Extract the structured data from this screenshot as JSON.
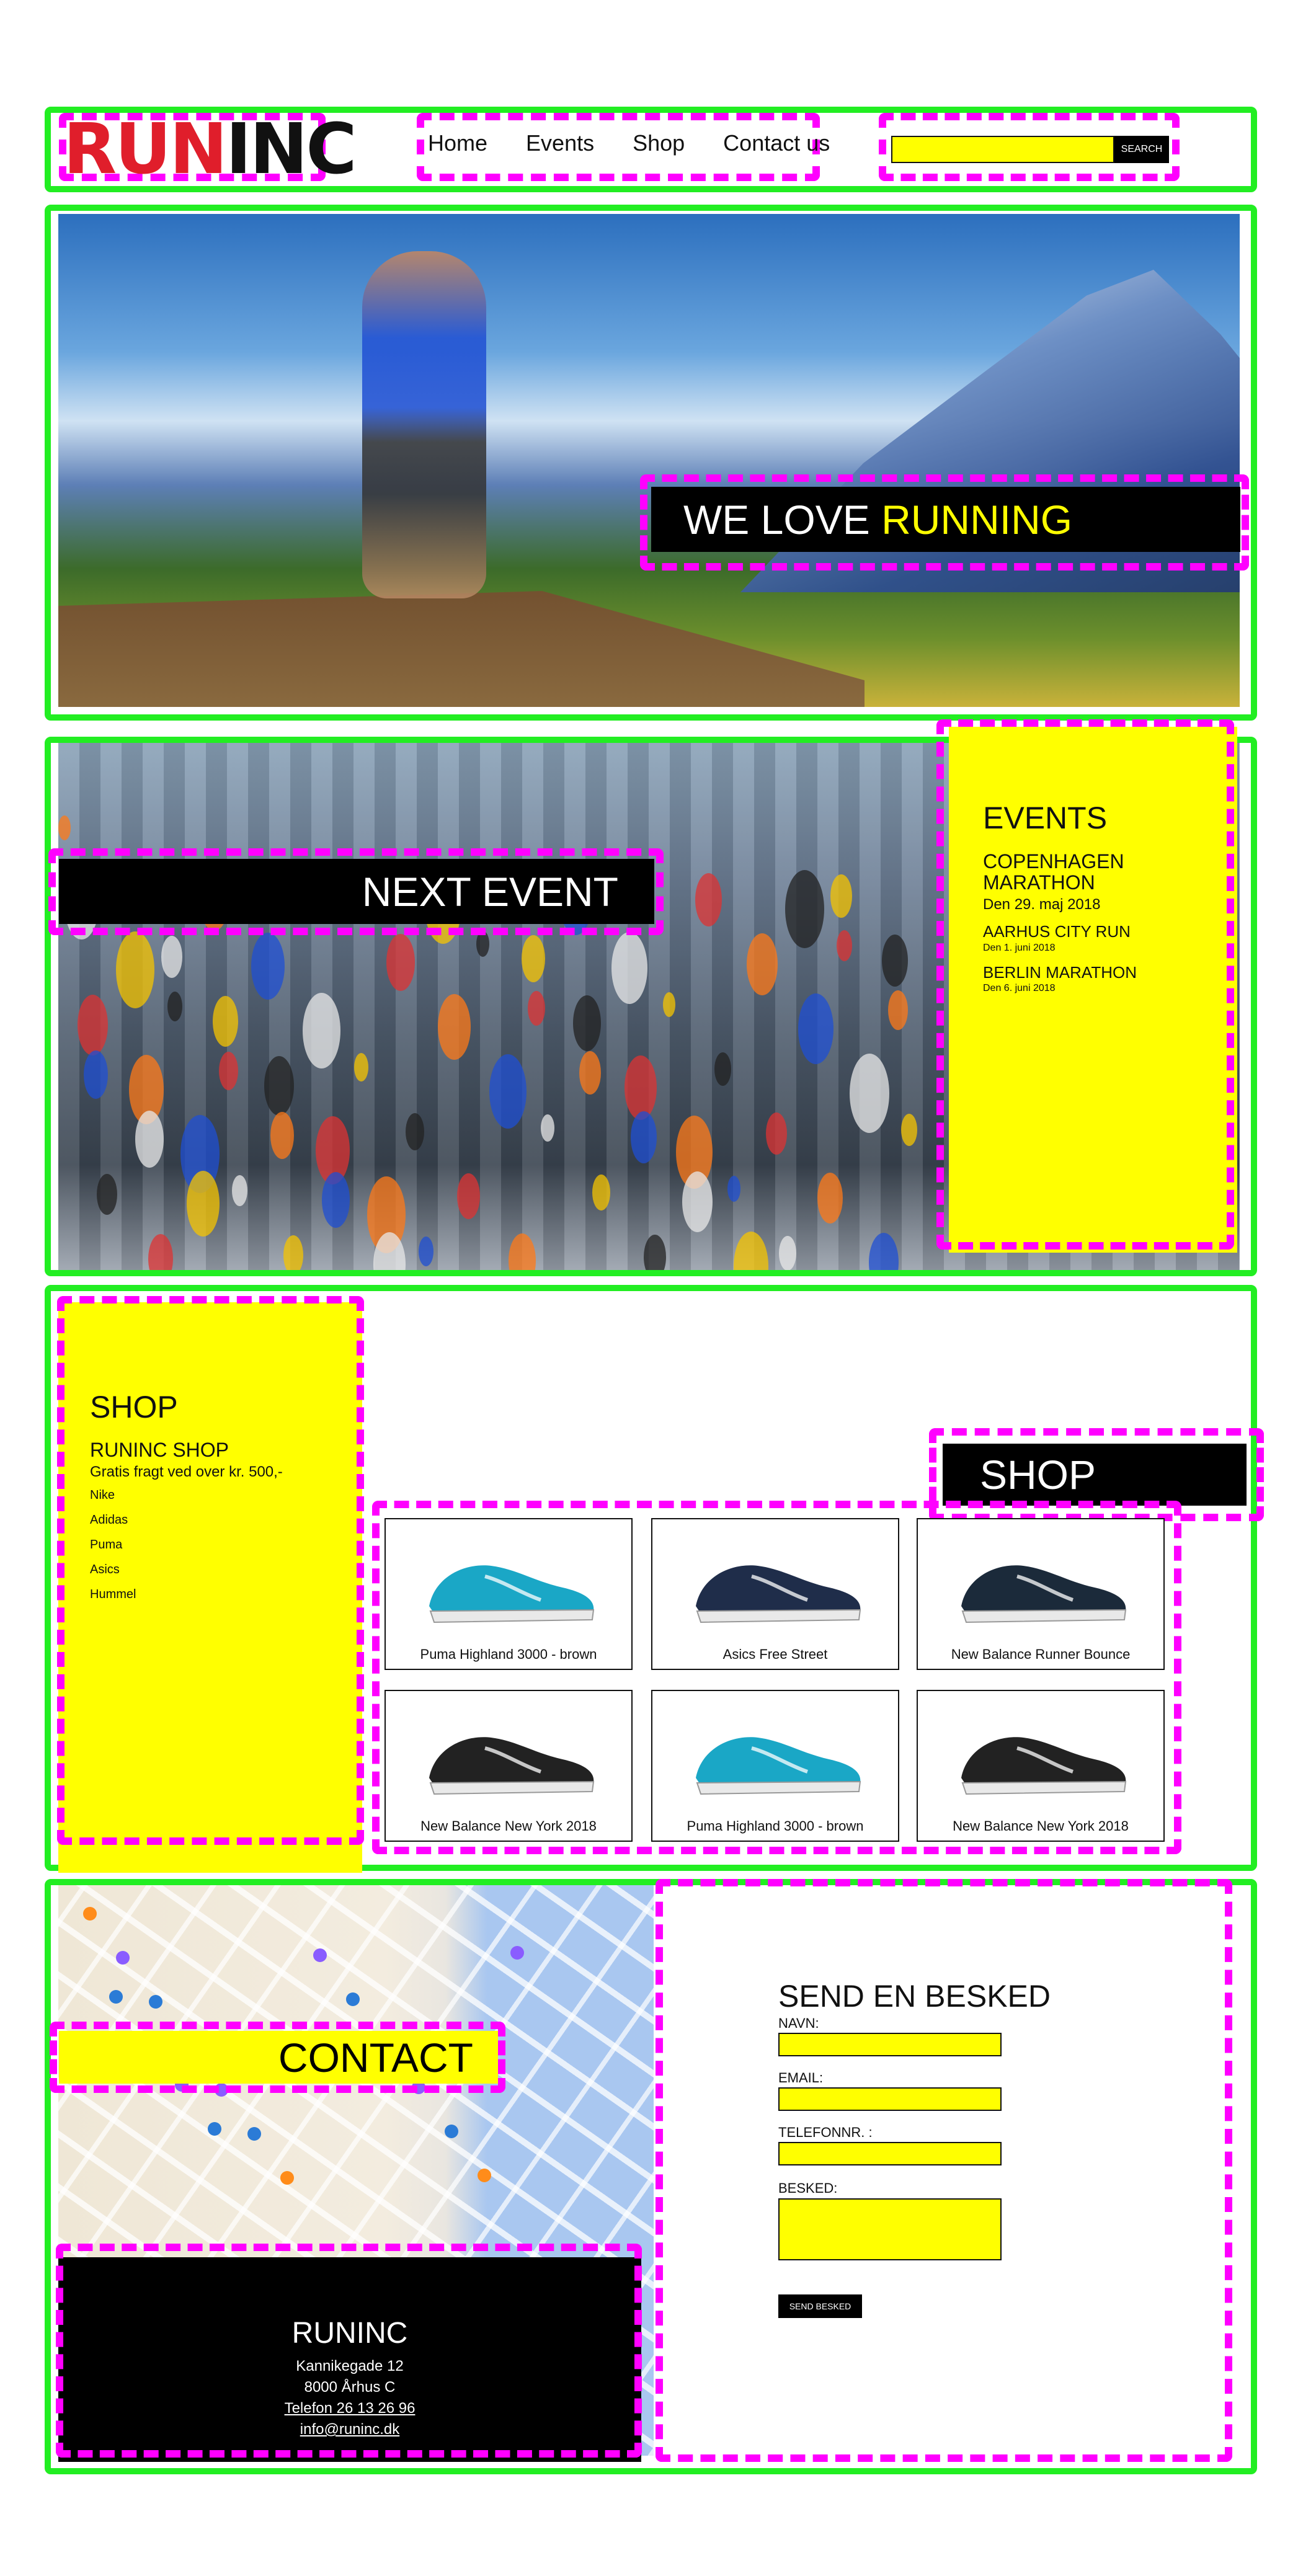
{
  "header": {
    "logo_run": "RUN",
    "logo_inc": "INC",
    "nav": [
      "Home",
      "Events",
      "Shop",
      "Contact us"
    ],
    "search_button": "SEARCH"
  },
  "hero": {
    "banner_prefix": "WE LOVE",
    "banner_highlight": "RUNNING"
  },
  "next_event": {
    "banner": "NEXT EVENT"
  },
  "events": {
    "title": "EVENTS",
    "main_event": "COPENHAGEN MARATHON",
    "main_date": "Den 29. maj 2018",
    "items": [
      {
        "name": "AARHUS CITY RUN",
        "date": "Den 1. juni 2018"
      },
      {
        "name": "BERLIN MARATHON",
        "date": "Den 6. juni 2018"
      }
    ]
  },
  "shop": {
    "title": "SHOP",
    "subtitle": "RUNINC SHOP",
    "free_shipping": "Gratis fragt ved over kr. 500,-",
    "brands": [
      "Nike",
      "Adidas",
      "Puma",
      "Asics",
      "Hummel"
    ],
    "banner": "SHOP",
    "products": [
      {
        "name": "Puma Highland 3000 - brown",
        "icon": "running-shoe-teal-icon",
        "color": "#1aa7c6"
      },
      {
        "name": "Asics Free Street",
        "icon": "running-shoe-navy-icon",
        "color": "#1f2d4a"
      },
      {
        "name": "New Balance Runner Bounce",
        "icon": "running-shoe-lime-icon",
        "color": "#1b2a3a"
      },
      {
        "name": "New Balance New York 2018",
        "icon": "running-shoe-orange-icon",
        "color": "#222"
      },
      {
        "name": "Puma Highland 3000 - brown",
        "icon": "running-shoe-teal-icon",
        "color": "#1aa7c6"
      },
      {
        "name": "New Balance New York 2018",
        "icon": "running-shoe-orange-icon",
        "color": "#222"
      }
    ]
  },
  "contact": {
    "banner": "CONTACT",
    "form_title": "SEND EN BESKED",
    "labels": {
      "name": "NAVN:",
      "email": "EMAIL:",
      "phone": "TELEFONNR. :",
      "message": "BESKED:"
    },
    "send_button": "SEND BESKED"
  },
  "footer": {
    "name": "RUNINC",
    "address1": "Kannikegade 12",
    "address2": "8000 Århus C",
    "phone": "Telefon 26 13 26 96",
    "email": "info@runinc.dk"
  },
  "colors": {
    "accent_yellow": "#ffff00",
    "logo_red": "#e01e2b",
    "outline_green": "#22ee22",
    "outline_magenta": "#ff00ff"
  }
}
